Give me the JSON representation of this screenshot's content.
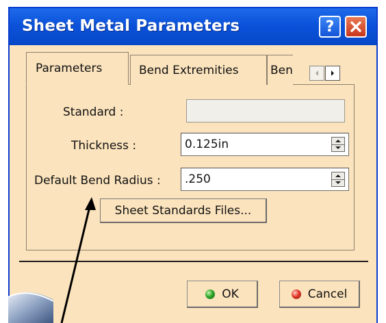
{
  "window": {
    "title": "Sheet Metal Parameters",
    "help_label": "?",
    "close_icon": "close-x-icon"
  },
  "tabs": [
    {
      "label": "Parameters",
      "active": true
    },
    {
      "label": "Bend Extremities",
      "active": false
    },
    {
      "label": "Ben",
      "active": false
    }
  ],
  "tab_scroll": {
    "left_icon": "chevron-left-icon",
    "right_icon": "chevron-right-icon"
  },
  "form": {
    "standard": {
      "label": "Standard :",
      "value": ""
    },
    "thickness": {
      "label": "Thickness :",
      "value": "0.125in"
    },
    "bend_radius": {
      "label": "Default Bend Radius :",
      "value": ".250"
    },
    "standards_button": "Sheet Standards Files..."
  },
  "buttons": {
    "ok": "OK",
    "cancel": "Cancel"
  },
  "colors": {
    "titlebar": "#0b52da",
    "dialog_bg": "#fbe3bd",
    "ok_dot": "#2fa72a",
    "cancel_dot": "#e23a2b"
  }
}
